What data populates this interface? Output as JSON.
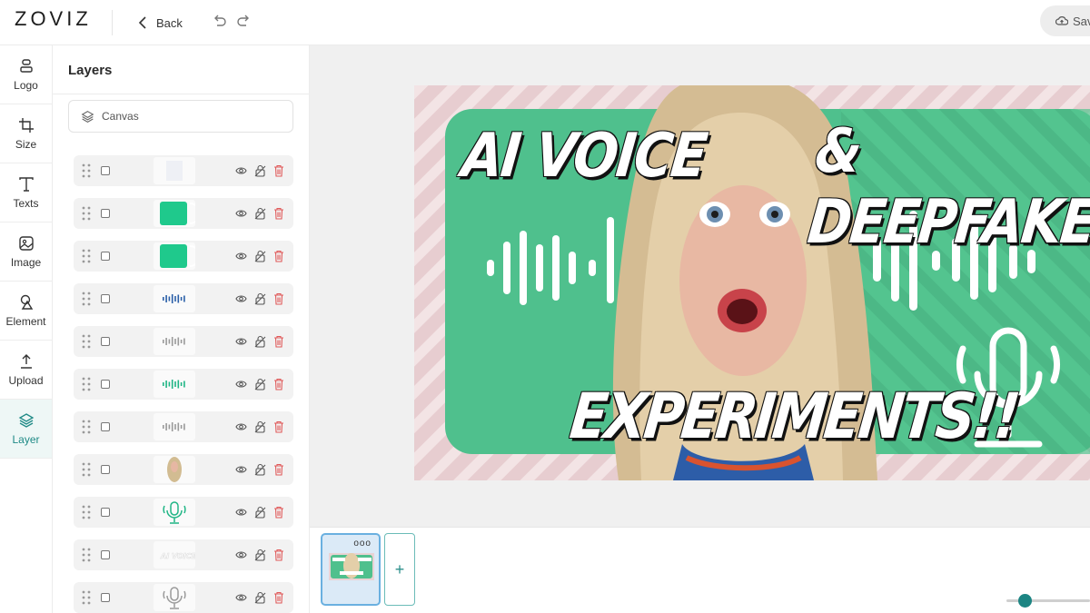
{
  "app": {
    "logo": "ZOVIZ"
  },
  "toolbar": {
    "back_label": "Back",
    "save_label": "Save"
  },
  "rail": {
    "items": [
      {
        "label": "Logo",
        "icon": "logo-icon"
      },
      {
        "label": "Size",
        "icon": "crop-icon"
      },
      {
        "label": "Texts",
        "icon": "text-icon"
      },
      {
        "label": "Image",
        "icon": "image-icon"
      },
      {
        "label": "Element",
        "icon": "shapes-icon"
      },
      {
        "label": "Upload",
        "icon": "upload-icon"
      },
      {
        "label": "Layer",
        "icon": "layers-icon",
        "active": true
      }
    ]
  },
  "layers_panel": {
    "title": "Layers",
    "canvas_label": "Canvas",
    "layers": [
      {
        "thumb": "blank"
      },
      {
        "thumb": "green-rect"
      },
      {
        "thumb": "green-rect"
      },
      {
        "thumb": "wave-blue"
      },
      {
        "thumb": "wave-gray"
      },
      {
        "thumb": "wave-green"
      },
      {
        "thumb": "wave-gray"
      },
      {
        "thumb": "photo"
      },
      {
        "thumb": "mic-green"
      },
      {
        "thumb": "text"
      },
      {
        "thumb": "mic-gray"
      }
    ]
  },
  "design": {
    "headline_1": "AI VOICE",
    "headline_2": "& DEEPFAKE",
    "headline_3": "EXPERIMENTS!!"
  },
  "pages": {
    "menu": "ooo",
    "add_label": "+"
  },
  "colors": {
    "accent": "#1c8583",
    "banner_green": "#4fc08d",
    "bg_pink": "#e9d2d4"
  },
  "zoom": {
    "level": 0.12
  }
}
